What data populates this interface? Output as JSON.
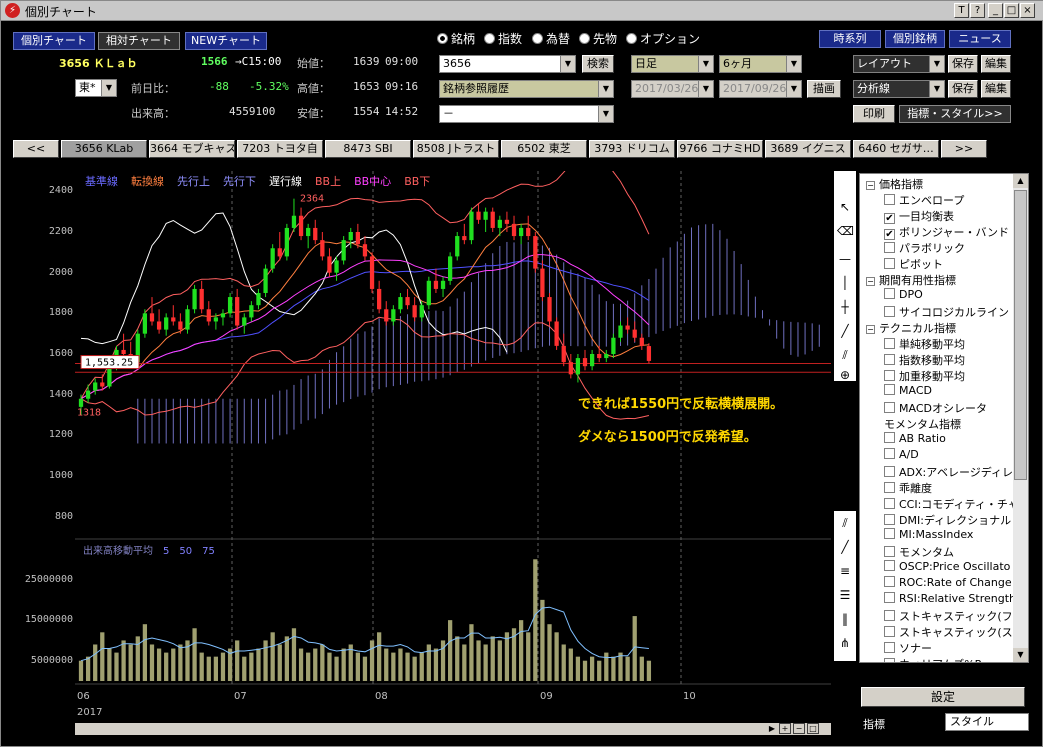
{
  "window": {
    "title": "個別チャート",
    "buttons": [
      "T",
      "?",
      "_",
      "□",
      "×"
    ]
  },
  "top_buttons": [
    "個別チャート",
    "相対チャート",
    "NEWチャート"
  ],
  "stock": {
    "code_name": "3656 ＫＬａｂ",
    "price": "1566",
    "time": "→C15:00",
    "exchange": "東*",
    "change_label": "前日比：",
    "change": "-88",
    "change_pct": "-5.32%",
    "volume_label": "出来高：",
    "volume": "4559100",
    "open_label": "始値：",
    "open": "1639",
    "open_time": "09:00",
    "high_label": "高値：",
    "high": "1653",
    "high_time": "09:16",
    "low_label": "安値：",
    "low": "1554",
    "low_time": "14:52"
  },
  "radios": [
    {
      "label": "銘柄",
      "on": true
    },
    {
      "label": "指数",
      "on": false
    },
    {
      "label": "為替",
      "on": false
    },
    {
      "label": "先物",
      "on": false
    },
    {
      "label": "オプション",
      "on": false
    }
  ],
  "search": {
    "value": "3656",
    "button": "検索",
    "history": "銘柄参照履歴",
    "third": "－"
  },
  "period": {
    "interval": "日足",
    "range": "6ヶ月",
    "from": "2017/03/26",
    "to": "2017/09/26",
    "draw": "描画"
  },
  "right_buttons": {
    "timeseries": "時系列",
    "individual": "個別銘柄",
    "news": "ニュース",
    "layout": "レイアウト",
    "save": "保存",
    "edit": "編集",
    "analysis": "分析線",
    "print": "印刷",
    "indicator_style": "指標・スタイル>>"
  },
  "tabs": [
    "<<",
    "3656 KLab",
    "3664 モブキャス",
    "7203 トヨタ自",
    "8473 SBI",
    "8508 Jトラスト",
    "6502 東芝",
    "3793 ドリコム",
    "9766 コナミHD",
    "3689 イグニス",
    "6460 セガサ…",
    ">>"
  ],
  "legend": [
    {
      "label": "基準線",
      "color": "#6a6aff"
    },
    {
      "label": "転換線",
      "color": "#ff7f3f"
    },
    {
      "label": "先行上",
      "color": "#9090ff"
    },
    {
      "label": "先行下",
      "color": "#9090ff"
    },
    {
      "label": "遅行線",
      "color": "#ffffff"
    },
    {
      "label": "BB上",
      "color": "#ff6060"
    },
    {
      "label": "BB中心",
      "color": "#ff40ff"
    },
    {
      "label": "BB下",
      "color": "#ff6060"
    }
  ],
  "volume_legend": {
    "label": "出来高移動平均",
    "periods": [
      "5",
      "50",
      "75"
    ]
  },
  "annotations": [
    "できれば1550円で反転横横展開。",
    "ダメなら1500円で反発希望。"
  ],
  "price_labels": {
    "current": "1,553.25",
    "high_mark": "2364",
    "low_mark": "1318"
  },
  "chart_data": {
    "type": "candlestick",
    "y_ticks": [
      "2400",
      "2200",
      "2000",
      "1800",
      "1600",
      "1400",
      "1200",
      "1000",
      "800"
    ],
    "ylim": [
      700,
      2500
    ],
    "x_ticks": [
      "06",
      "07",
      "08",
      "09",
      "10"
    ],
    "year": "2017",
    "volume_ticks": [
      "25000000",
      "15000000",
      "5000000"
    ],
    "volume_ylim": [
      0,
      35000000
    ],
    "candles": [
      [
        1340,
        1400,
        1300,
        1380
      ],
      [
        1380,
        1450,
        1360,
        1420
      ],
      [
        1420,
        1480,
        1400,
        1460
      ],
      [
        1460,
        1500,
        1420,
        1440
      ],
      [
        1440,
        1560,
        1430,
        1540
      ],
      [
        1540,
        1640,
        1520,
        1620
      ],
      [
        1620,
        1700,
        1580,
        1600
      ],
      [
        1600,
        1660,
        1540,
        1560
      ],
      [
        1560,
        1720,
        1550,
        1700
      ],
      [
        1700,
        1820,
        1680,
        1800
      ],
      [
        1800,
        1880,
        1740,
        1760
      ],
      [
        1760,
        1820,
        1700,
        1720
      ],
      [
        1720,
        1800,
        1690,
        1780
      ],
      [
        1780,
        1840,
        1740,
        1760
      ],
      [
        1760,
        1800,
        1700,
        1720
      ],
      [
        1720,
        1840,
        1700,
        1820
      ],
      [
        1820,
        1940,
        1800,
        1920
      ],
      [
        1920,
        1960,
        1800,
        1820
      ],
      [
        1820,
        1860,
        1740,
        1760
      ],
      [
        1760,
        1800,
        1720,
        1780
      ],
      [
        1780,
        1820,
        1740,
        1800
      ],
      [
        1800,
        1900,
        1780,
        1880
      ],
      [
        1880,
        1920,
        1720,
        1740
      ],
      [
        1740,
        1800,
        1700,
        1780
      ],
      [
        1780,
        1860,
        1760,
        1840
      ],
      [
        1840,
        1920,
        1820,
        1900
      ],
      [
        1900,
        2040,
        1880,
        2020
      ],
      [
        2020,
        2140,
        2000,
        2120
      ],
      [
        2120,
        2200,
        2060,
        2080
      ],
      [
        2080,
        2240,
        2060,
        2220
      ],
      [
        2220,
        2364,
        2200,
        2280
      ],
      [
        2280,
        2320,
        2160,
        2180
      ],
      [
        2180,
        2240,
        2120,
        2220
      ],
      [
        2220,
        2260,
        2140,
        2160
      ],
      [
        2160,
        2200,
        2060,
        2080
      ],
      [
        2080,
        2120,
        1980,
        2000
      ],
      [
        2000,
        2080,
        1960,
        2060
      ],
      [
        2060,
        2180,
        2040,
        2160
      ],
      [
        2160,
        2220,
        2120,
        2200
      ],
      [
        2200,
        2240,
        2120,
        2140
      ],
      [
        2140,
        2180,
        2060,
        2080
      ],
      [
        2080,
        2100,
        1900,
        1920
      ],
      [
        1920,
        1960,
        1800,
        1820
      ],
      [
        1820,
        1860,
        1740,
        1760
      ],
      [
        1760,
        1840,
        1740,
        1820
      ],
      [
        1820,
        1900,
        1800,
        1880
      ],
      [
        1880,
        1920,
        1820,
        1840
      ],
      [
        1840,
        1880,
        1760,
        1780
      ],
      [
        1780,
        1860,
        1760,
        1840
      ],
      [
        1840,
        1980,
        1820,
        1960
      ],
      [
        1960,
        2020,
        1900,
        1920
      ],
      [
        1920,
        1980,
        1880,
        1960
      ],
      [
        1960,
        2100,
        1940,
        2080
      ],
      [
        2080,
        2200,
        2060,
        2180
      ],
      [
        2180,
        2240,
        2140,
        2160
      ],
      [
        2160,
        2320,
        2140,
        2300
      ],
      [
        2300,
        2340,
        2240,
        2260
      ],
      [
        2260,
        2320,
        2200,
        2300
      ],
      [
        2300,
        2320,
        2200,
        2220
      ],
      [
        2220,
        2280,
        2180,
        2260
      ],
      [
        2260,
        2300,
        2200,
        2240
      ],
      [
        2240,
        2280,
        2160,
        2180
      ],
      [
        2180,
        2240,
        2140,
        2220
      ],
      [
        2220,
        2280,
        2160,
        2180
      ],
      [
        2180,
        2200,
        2000,
        2020
      ],
      [
        2020,
        2060,
        1860,
        1880
      ],
      [
        1880,
        1900,
        1740,
        1760
      ],
      [
        1760,
        1780,
        1620,
        1640
      ],
      [
        1640,
        1700,
        1540,
        1560
      ],
      [
        1560,
        1600,
        1480,
        1500
      ],
      [
        1500,
        1600,
        1460,
        1580
      ],
      [
        1580,
        1620,
        1520,
        1540
      ],
      [
        1540,
        1620,
        1520,
        1600
      ],
      [
        1600,
        1640,
        1560,
        1580
      ],
      [
        1580,
        1620,
        1560,
        1600
      ],
      [
        1600,
        1700,
        1580,
        1680
      ],
      [
        1680,
        1760,
        1660,
        1740
      ],
      [
        1740,
        1780,
        1700,
        1720
      ],
      [
        1720,
        1760,
        1660,
        1680
      ],
      [
        1680,
        1700,
        1620,
        1640
      ],
      [
        1639,
        1653,
        1554,
        1566
      ]
    ],
    "volumes": [
      5,
      6,
      9,
      12,
      8,
      7,
      10,
      9,
      11,
      14,
      9,
      8,
      7,
      8,
      9,
      10,
      13,
      7,
      6,
      6,
      7,
      8,
      10,
      6,
      7,
      8,
      10,
      12,
      9,
      11,
      13,
      8,
      7,
      8,
      9,
      7,
      6,
      8,
      9,
      7,
      6,
      10,
      12,
      8,
      7,
      8,
      7,
      6,
      7,
      9,
      8,
      10,
      15,
      11,
      9,
      14,
      10,
      9,
      11,
      10,
      12,
      13,
      15,
      12,
      30,
      20,
      14,
      12,
      9,
      8,
      6,
      5,
      6,
      5,
      7,
      6,
      7,
      6,
      16,
      6,
      5
    ]
  },
  "side_panel": {
    "items": [
      {
        "type": "group",
        "label": "価格指標"
      },
      {
        "type": "check",
        "label": "エンベロープ",
        "checked": false
      },
      {
        "type": "check",
        "label": "一目均衡表",
        "checked": true
      },
      {
        "type": "check",
        "label": "ボリンジャー・バンド",
        "checked": true
      },
      {
        "type": "check",
        "label": "パラボリック",
        "checked": false
      },
      {
        "type": "check",
        "label": "ピボット",
        "checked": false
      },
      {
        "type": "group",
        "label": "期間有用性指標"
      },
      {
        "type": "check",
        "label": "DPO",
        "checked": false
      },
      {
        "type": "check",
        "label": "サイコロジカルライン",
        "checked": false
      },
      {
        "type": "group",
        "label": "テクニカル指標"
      },
      {
        "type": "check",
        "label": "単純移動平均",
        "checked": false
      },
      {
        "type": "check",
        "label": "指数移動平均",
        "checked": false
      },
      {
        "type": "check",
        "label": "加重移動平均",
        "checked": false
      },
      {
        "type": "check",
        "label": "MACD",
        "checked": false
      },
      {
        "type": "check",
        "label": "MACDオシレータ",
        "checked": false
      },
      {
        "type": "plain",
        "label": "モメンタム指標"
      },
      {
        "type": "check",
        "label": "AB Ratio",
        "checked": false
      },
      {
        "type": "check",
        "label": "A/D",
        "checked": false
      },
      {
        "type": "check",
        "label": "ADX:アベレージディレ",
        "checked": false
      },
      {
        "type": "check",
        "label": "乖離度",
        "checked": false
      },
      {
        "type": "check",
        "label": "CCI:コモディティ・チャ",
        "checked": false
      },
      {
        "type": "check",
        "label": "DMI:ディレクショナル",
        "checked": false
      },
      {
        "type": "check",
        "label": "MI:MassIndex",
        "checked": false
      },
      {
        "type": "check",
        "label": "モメンタム",
        "checked": false
      },
      {
        "type": "check",
        "label": "OSCP:Price Oscillato",
        "checked": false
      },
      {
        "type": "check",
        "label": "ROC:Rate of Change",
        "checked": false
      },
      {
        "type": "check",
        "label": "RSI:Relative Strength",
        "checked": false
      },
      {
        "type": "check",
        "label": "ストキャスティック(フ",
        "checked": false
      },
      {
        "type": "check",
        "label": "ストキャスティック(ス",
        "checked": false
      },
      {
        "type": "check",
        "label": "ソナー",
        "checked": false
      },
      {
        "type": "check",
        "label": "ウィリアムズ%R",
        "checked": false
      }
    ],
    "settings": "設定",
    "bottom_tabs": [
      "指標",
      "スタイル"
    ]
  }
}
